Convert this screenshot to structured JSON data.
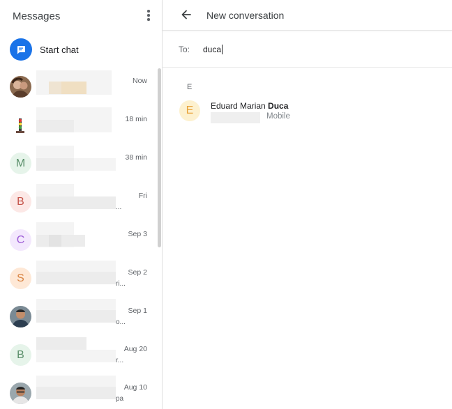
{
  "sidebar": {
    "title": "Messages",
    "menu_icon": "more-vert-icon",
    "start_chat": {
      "label": "Start chat",
      "icon": "chat-bubble-icon",
      "color": "#1a73e8"
    },
    "conversations": [
      {
        "avatar_kind": "photo",
        "initial": "",
        "time": "Now",
        "trail": ""
      },
      {
        "avatar_kind": "photo",
        "initial": "",
        "time": "18 min",
        "trail": ""
      },
      {
        "avatar_kind": "letter",
        "initial": "M",
        "bg": "#e6f4ea",
        "fg": "#5a8f6a",
        "time": "38 min",
        "trail": ""
      },
      {
        "avatar_kind": "letter",
        "initial": "B",
        "bg": "#fce8e6",
        "fg": "#c5554b",
        "time": "Fri",
        "trail": "..."
      },
      {
        "avatar_kind": "letter",
        "initial": "C",
        "bg": "#f3e8fd",
        "fg": "#9d5bd6",
        "time": "Sep 3",
        "trail": ""
      },
      {
        "avatar_kind": "letter",
        "initial": "S",
        "bg": "#fee8d6",
        "fg": "#d98443",
        "time": "Sep 2",
        "trail": "ri..."
      },
      {
        "avatar_kind": "photo",
        "initial": "",
        "time": "Sep 1",
        "trail": "o..."
      },
      {
        "avatar_kind": "letter",
        "initial": "B",
        "bg": "#e6f4ea",
        "fg": "#5a8f6a",
        "time": "Aug 20",
        "trail": "r..."
      },
      {
        "avatar_kind": "photo",
        "initial": "",
        "time": "Aug 10",
        "trail": "pa"
      }
    ]
  },
  "main": {
    "header": {
      "back_icon": "arrow-back-icon",
      "title": "New conversation"
    },
    "to": {
      "label": "To:",
      "value": "duca"
    },
    "results": {
      "section_letter": "E",
      "contact": {
        "initial": "E",
        "name_prefix": "Eduard Marian ",
        "name_match": "Duca",
        "type": "Mobile"
      }
    }
  }
}
